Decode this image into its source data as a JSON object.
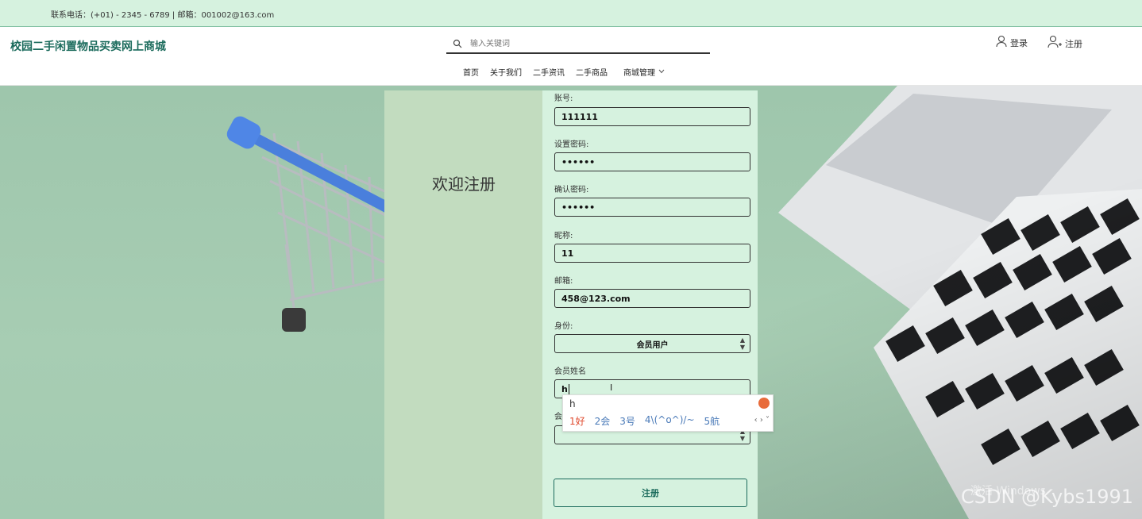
{
  "topbar": {
    "contact": "联系电话：(+01) - 2345 - 6789 | 邮箱：001002@163.com"
  },
  "header": {
    "brand": "校园二手闲置物品买卖网上商城",
    "search_placeholder": "输入关键词",
    "login": "登录",
    "register": "注册",
    "nav": [
      "首页",
      "关于我们",
      "二手资讯",
      "二手商品",
      "商城管理"
    ]
  },
  "welcome": "欢迎注册",
  "form": {
    "account_label": "账号:",
    "account_value": "111111",
    "password_label": "设置密码:",
    "password_value": "••••••",
    "confirm_label": "确认密码:",
    "confirm_value": "••••••",
    "nickname_label": "昵称:",
    "nickname_value": "11",
    "email_label": "邮箱:",
    "email_value": "458@123.com",
    "role_label": "身份:",
    "role_value": "会员用户",
    "member_name_label": "会员姓名",
    "member_name_value": "h",
    "next_label": "会",
    "submit": "注册"
  },
  "ime": {
    "typed": "h",
    "candidates": [
      "1好",
      "2会",
      "3号",
      "4\\(^o^)/~",
      "5航"
    ],
    "pager": "‹ › ˅"
  },
  "watermark": "CSDN @Kybs1991",
  "windows_text": "激活 Windows"
}
